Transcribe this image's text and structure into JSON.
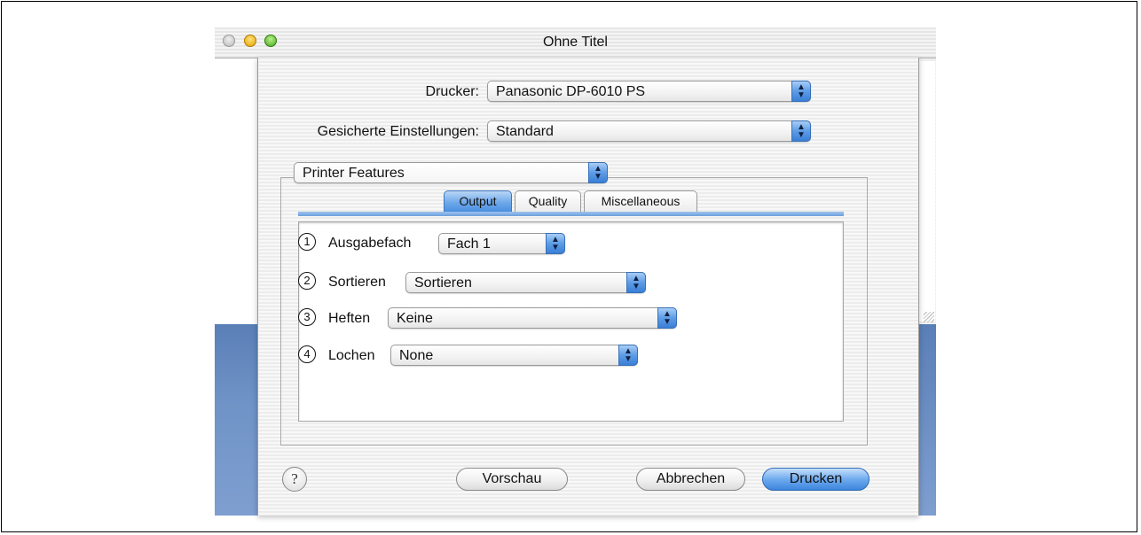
{
  "window": {
    "title": "Ohne Titel"
  },
  "printer": {
    "label": "Drucker:",
    "value": "Panasonic DP-6010 PS"
  },
  "presets": {
    "label": "Gesicherte Einstellungen:",
    "value": "Standard"
  },
  "panel_popup": {
    "value": "Printer Features"
  },
  "tabs": [
    {
      "label": "Output",
      "selected": true
    },
    {
      "label": "Quality",
      "selected": false
    },
    {
      "label": "Miscellaneous",
      "selected": false
    }
  ],
  "options": [
    {
      "marker": "1",
      "label": "Ausgabefach",
      "value": "Fach 1"
    },
    {
      "marker": "2",
      "label": "Sortieren",
      "value": "Sortieren"
    },
    {
      "marker": "3",
      "label": "Heften",
      "value": "Keine"
    },
    {
      "marker": "4",
      "label": "Lochen",
      "value": "None"
    }
  ],
  "buttons": {
    "help": "?",
    "preview": "Vorschau",
    "cancel": "Abbrechen",
    "print": "Drucken"
  },
  "icons": {
    "popup_arrows": "up-down-arrows-icon",
    "help": "question-mark-icon"
  },
  "colors": {
    "accent": "#4b8fdf",
    "desktop": "#6f93c6"
  }
}
